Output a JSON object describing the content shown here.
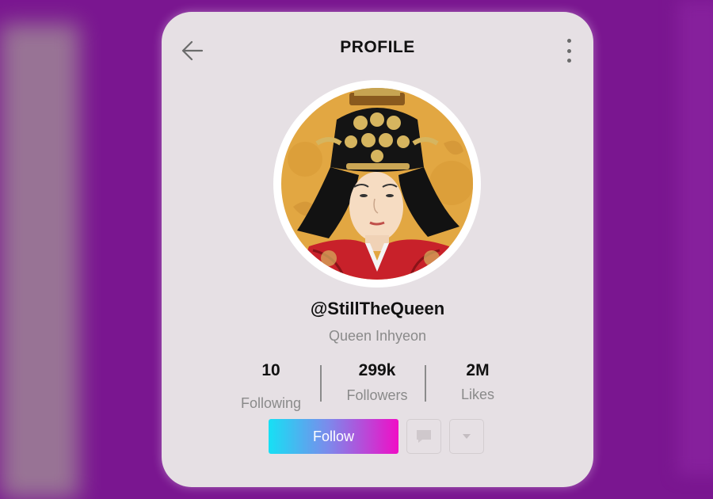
{
  "header": {
    "title": "PROFILE",
    "back_icon": "arrow-left-icon",
    "menu_icon": "more-vertical-icon"
  },
  "profile": {
    "handle": "@StillTheQueen",
    "display_name": "Queen Inhyeon",
    "avatar": "portrait-painting-queen"
  },
  "stats": [
    {
      "value": "10",
      "label": "Following"
    },
    {
      "value": "299k",
      "label": "Followers"
    },
    {
      "value": "2M",
      "label": "Likes"
    }
  ],
  "actions": {
    "follow_label": "Follow",
    "message_icon": "message-icon",
    "dropdown_icon": "caret-down-icon"
  },
  "colors": {
    "background": "#7a1690",
    "card": "#e6e0e4",
    "follow_gradient_start": "#16e0f4",
    "follow_gradient_end": "#f00ec6"
  }
}
